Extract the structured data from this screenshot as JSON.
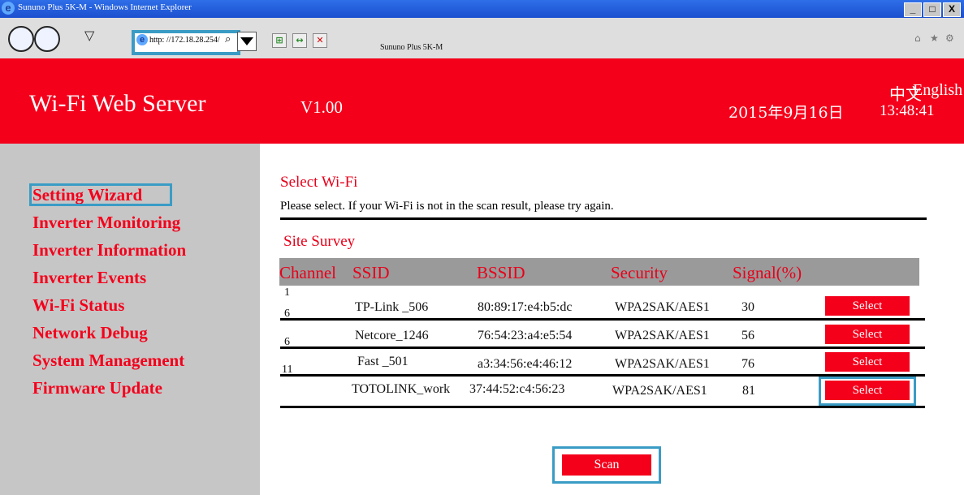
{
  "window": {
    "title": "Sununo Plus 5K-M  -  Windows Internet Explorer",
    "controls": [
      "_",
      "□",
      "X"
    ]
  },
  "browser": {
    "address": "http: //172.18.28.254/",
    "tab_title": "Sununo Plus 5K-M",
    "icons": [
      "back-icon",
      "forward-icon",
      "ie-logo-icon",
      "search-icon",
      "compat-icon",
      "refresh-icon",
      "stop-icon",
      "home-icon",
      "favorites-icon",
      "tools-icon"
    ]
  },
  "header": {
    "title": "Wi-Fi Web Server",
    "version": "V1.00",
    "lang_zh": "中文",
    "lang_en": "English",
    "date": "2015年9月16日",
    "time": "13:48:41"
  },
  "sidebar": {
    "items": [
      {
        "label": "Setting Wizard"
      },
      {
        "label": "Inverter Monitoring"
      },
      {
        "label": "Inverter Information"
      },
      {
        "label": "Inverter Events"
      },
      {
        "label": "Wi-Fi Status"
      },
      {
        "label": "Network Debug"
      },
      {
        "label": "System Management"
      },
      {
        "label": "Firmware Update"
      }
    ]
  },
  "main": {
    "section_title": "Select Wi-Fi",
    "instruction": "Please select. If your Wi-Fi  is not in the scan result, please try again.",
    "survey_title": "Site Survey",
    "columns": [
      "Channel",
      "SSID",
      "BSSID",
      "Security",
      "Signal(%)"
    ],
    "rows": [
      {
        "channel": "1",
        "ssid": "TP-Link _506",
        "bssid": "80:89:17:e4:b5:dc",
        "security": "WPA2SAK/AES1",
        "signal": "30",
        "action": "Select"
      },
      {
        "channel": "6",
        "ssid": "Netcore_1246",
        "bssid": "76:54:23:a4:e5:54",
        "security": "WPA2SAK/AES1",
        "signal": "56",
        "action": "Select"
      },
      {
        "channel": "6",
        "ssid": "Fast _501",
        "bssid": "a3:34:56:e4:46:12",
        "security": "WPA2SAK/AES1",
        "signal": "76",
        "action": "Select"
      },
      {
        "channel": "11",
        "ssid": "TOTOLINK_work",
        "bssid": "37:44:52:c4:56:23",
        "security": "WPA2SAK/AES1",
        "signal": "81",
        "action": "Select"
      }
    ],
    "scan_label": "Scan"
  },
  "colors": {
    "brand_red": "#f4001b",
    "sidebar_gray": "#c6c6c6",
    "table_header_gray": "#9a9a9a",
    "highlight_blue": "#3a9cc5"
  }
}
